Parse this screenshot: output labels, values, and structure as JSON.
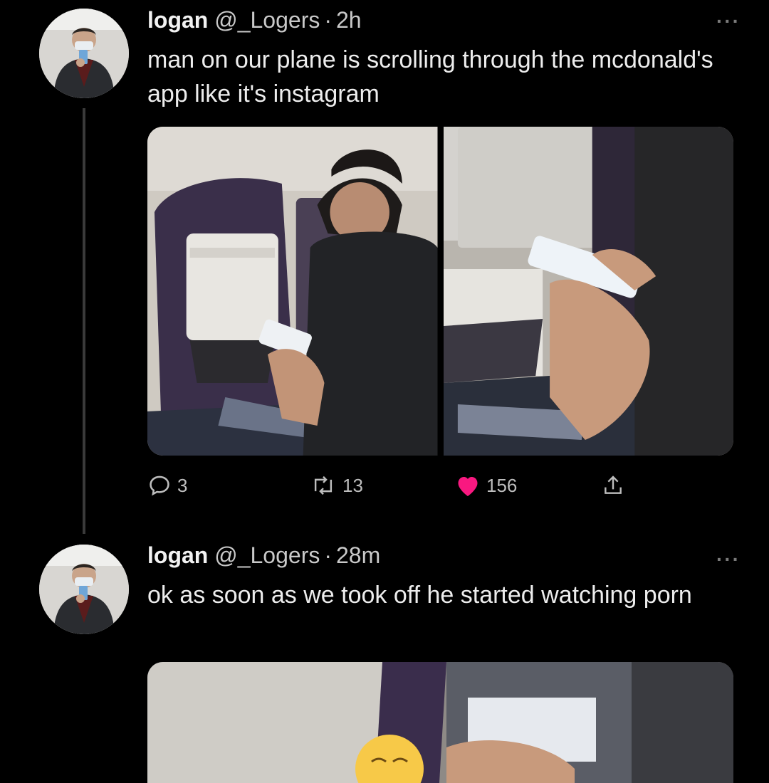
{
  "tweets": [
    {
      "name": "logan",
      "handle": "@_Logers",
      "separator": "·",
      "time": "2h",
      "text": "man on our plane is scrolling through the mcdonald's app like it's instagram",
      "more": "···",
      "actions": {
        "replies": "3",
        "retweets": "13",
        "likes": "156"
      }
    },
    {
      "name": "logan",
      "handle": "@_Logers",
      "separator": "·",
      "time": "28m",
      "text": "ok as soon as we took off he started watching porn",
      "more": "···"
    }
  ],
  "icons": {
    "reply": "reply-icon",
    "retweet": "retweet-icon",
    "like": "heart-icon",
    "share": "share-icon",
    "more": "more-icon"
  },
  "colors": {
    "background": "#000000",
    "like_active": "#f91880",
    "text": "#e7e9ea",
    "secondary": "#c9c9c9"
  }
}
